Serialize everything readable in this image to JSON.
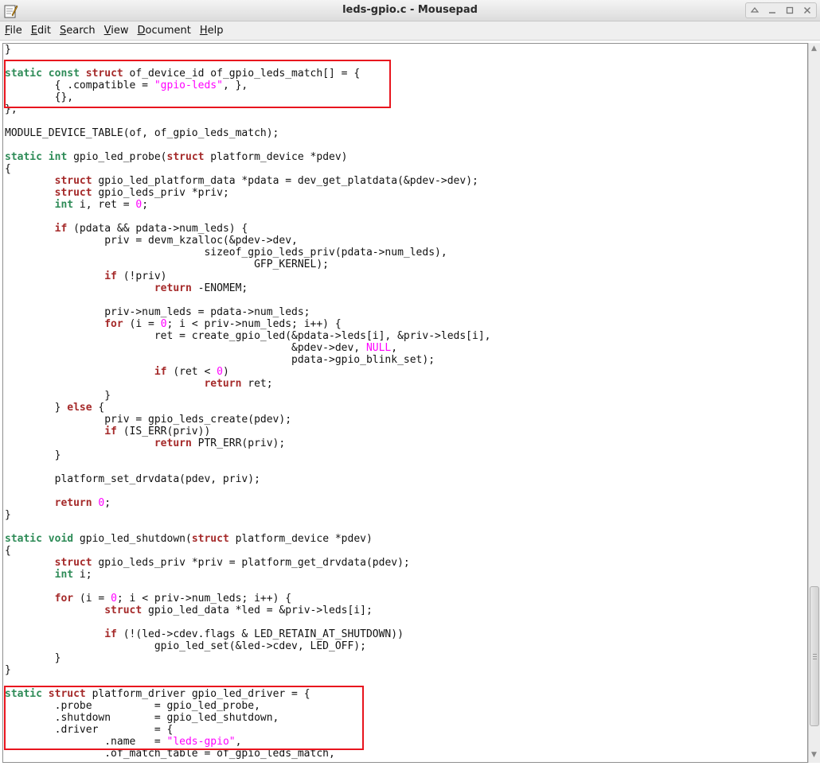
{
  "window": {
    "title": "leds-gpio.c - Mousepad",
    "controls": [
      "up-icon",
      "minimize-icon",
      "maximize-icon",
      "close-icon"
    ]
  },
  "menubar": {
    "items": [
      {
        "label": "File",
        "mnemonic": "F",
        "rest": "ile"
      },
      {
        "label": "Edit",
        "mnemonic": "E",
        "rest": "dit"
      },
      {
        "label": "Search",
        "mnemonic": "S",
        "rest": "earch"
      },
      {
        "label": "View",
        "mnemonic": "V",
        "rest": "iew"
      },
      {
        "label": "Document",
        "mnemonic": "D",
        "rest": "ocument"
      },
      {
        "label": "Help",
        "mnemonic": "H",
        "rest": "elp"
      }
    ]
  },
  "editor": {
    "file": "leds-gpio.c",
    "lines": [
      [
        [
          "}",
          ""
        ]
      ],
      [
        [
          "",
          ""
        ]
      ],
      [
        [
          "static",
          "ty"
        ],
        [
          " ",
          ""
        ],
        [
          "const",
          "ty"
        ],
        [
          " ",
          ""
        ],
        [
          "struct",
          "kw"
        ],
        [
          " of_device_id of_gpio_leds_match[] = {",
          ""
        ]
      ],
      [
        [
          "\t{ .compatible = ",
          ""
        ],
        [
          "\"gpio-leds\"",
          "str"
        ],
        [
          ", },",
          ""
        ]
      ],
      [
        [
          "\t{},",
          ""
        ]
      ],
      [
        [
          "};",
          ""
        ]
      ],
      [
        [
          "",
          ""
        ]
      ],
      [
        [
          "MODULE_DEVICE_TABLE(of, of_gpio_leds_match);",
          ""
        ]
      ],
      [
        [
          "",
          ""
        ]
      ],
      [
        [
          "static",
          "ty"
        ],
        [
          " ",
          ""
        ],
        [
          "int",
          "ty"
        ],
        [
          " gpio_led_probe(",
          ""
        ],
        [
          "struct",
          "kw"
        ],
        [
          " platform_device *pdev)",
          ""
        ]
      ],
      [
        [
          "{",
          ""
        ]
      ],
      [
        [
          "\t",
          ""
        ],
        [
          "struct",
          "kw"
        ],
        [
          " gpio_led_platform_data *pdata = dev_get_platdata(&pdev->dev);",
          ""
        ]
      ],
      [
        [
          "\t",
          ""
        ],
        [
          "struct",
          "kw"
        ],
        [
          " gpio_leds_priv *priv;",
          ""
        ]
      ],
      [
        [
          "\t",
          ""
        ],
        [
          "int",
          "ty"
        ],
        [
          " i, ret = ",
          ""
        ],
        [
          "0",
          "num"
        ],
        [
          ";",
          ""
        ]
      ],
      [
        [
          "",
          ""
        ]
      ],
      [
        [
          "\t",
          ""
        ],
        [
          "if",
          "kw"
        ],
        [
          " (pdata && pdata->num_leds) {",
          ""
        ]
      ],
      [
        [
          "\t\tpriv = devm_kzalloc(&pdev->dev,",
          ""
        ]
      ],
      [
        [
          "\t\t\t\tsizeof_gpio_leds_priv(pdata->num_leds),",
          ""
        ]
      ],
      [
        [
          "\t\t\t\t\tGFP_KERNEL);",
          ""
        ]
      ],
      [
        [
          "\t\t",
          ""
        ],
        [
          "if",
          "kw"
        ],
        [
          " (!priv)",
          ""
        ]
      ],
      [
        [
          "\t\t\t",
          ""
        ],
        [
          "return",
          "kw"
        ],
        [
          " -ENOMEM;",
          ""
        ]
      ],
      [
        [
          "",
          ""
        ]
      ],
      [
        [
          "\t\tpriv->num_leds = pdata->num_leds;",
          ""
        ]
      ],
      [
        [
          "\t\t",
          ""
        ],
        [
          "for",
          "kw"
        ],
        [
          " (i = ",
          ""
        ],
        [
          "0",
          "num"
        ],
        [
          "; i < priv->num_leds; i++) {",
          ""
        ]
      ],
      [
        [
          "\t\t\tret = create_gpio_led(&pdata->leds[i], &priv->leds[i],",
          ""
        ]
      ],
      [
        [
          "\t\t\t\t\t      &pdev->dev, ",
          ""
        ],
        [
          "NULL",
          "num"
        ],
        [
          ",",
          ""
        ]
      ],
      [
        [
          "\t\t\t\t\t      pdata->gpio_blink_set);",
          ""
        ]
      ],
      [
        [
          "\t\t\t",
          ""
        ],
        [
          "if",
          "kw"
        ],
        [
          " (ret < ",
          ""
        ],
        [
          "0",
          "num"
        ],
        [
          ")",
          ""
        ]
      ],
      [
        [
          "\t\t\t\t",
          ""
        ],
        [
          "return",
          "kw"
        ],
        [
          " ret;",
          ""
        ]
      ],
      [
        [
          "\t\t}",
          ""
        ]
      ],
      [
        [
          "\t} ",
          ""
        ],
        [
          "else",
          "kw"
        ],
        [
          " {",
          ""
        ]
      ],
      [
        [
          "\t\tpriv = gpio_leds_create(pdev);",
          ""
        ]
      ],
      [
        [
          "\t\t",
          ""
        ],
        [
          "if",
          "kw"
        ],
        [
          " (IS_ERR(priv))",
          ""
        ]
      ],
      [
        [
          "\t\t\t",
          ""
        ],
        [
          "return",
          "kw"
        ],
        [
          " PTR_ERR(priv);",
          ""
        ]
      ],
      [
        [
          "\t}",
          ""
        ]
      ],
      [
        [
          "",
          ""
        ]
      ],
      [
        [
          "\tplatform_set_drvdata(pdev, priv);",
          ""
        ]
      ],
      [
        [
          "",
          ""
        ]
      ],
      [
        [
          "\t",
          ""
        ],
        [
          "return",
          "kw"
        ],
        [
          " ",
          ""
        ],
        [
          "0",
          "num"
        ],
        [
          ";",
          ""
        ]
      ],
      [
        [
          "}",
          ""
        ]
      ],
      [
        [
          "",
          ""
        ]
      ],
      [
        [
          "static",
          "ty"
        ],
        [
          " ",
          ""
        ],
        [
          "void",
          "ty"
        ],
        [
          " gpio_led_shutdown(",
          ""
        ],
        [
          "struct",
          "kw"
        ],
        [
          " platform_device *pdev)",
          ""
        ]
      ],
      [
        [
          "{",
          ""
        ]
      ],
      [
        [
          "\t",
          ""
        ],
        [
          "struct",
          "kw"
        ],
        [
          " gpio_leds_priv *priv = platform_get_drvdata(pdev);",
          ""
        ]
      ],
      [
        [
          "\t",
          ""
        ],
        [
          "int",
          "ty"
        ],
        [
          " i;",
          ""
        ]
      ],
      [
        [
          "",
          ""
        ]
      ],
      [
        [
          "\t",
          ""
        ],
        [
          "for",
          "kw"
        ],
        [
          " (i = ",
          ""
        ],
        [
          "0",
          "num"
        ],
        [
          "; i < priv->num_leds; i++) {",
          ""
        ]
      ],
      [
        [
          "\t\t",
          ""
        ],
        [
          "struct",
          "kw"
        ],
        [
          " gpio_led_data *led = &priv->leds[i];",
          ""
        ]
      ],
      [
        [
          "",
          ""
        ]
      ],
      [
        [
          "\t\t",
          ""
        ],
        [
          "if",
          "kw"
        ],
        [
          " (!(led->cdev.flags & LED_RETAIN_AT_SHUTDOWN))",
          ""
        ]
      ],
      [
        [
          "\t\t\tgpio_led_set(&led->cdev, LED_OFF);",
          ""
        ]
      ],
      [
        [
          "\t}",
          ""
        ]
      ],
      [
        [
          "}",
          ""
        ]
      ],
      [
        [
          "",
          ""
        ]
      ],
      [
        [
          "static",
          "ty"
        ],
        [
          " ",
          ""
        ],
        [
          "struct",
          "kw"
        ],
        [
          " platform_driver gpio_led_driver = {",
          ""
        ]
      ],
      [
        [
          "\t.probe\t\t= gpio_led_probe,",
          ""
        ]
      ],
      [
        [
          "\t.shutdown\t= gpio_led_shutdown,",
          ""
        ]
      ],
      [
        [
          "\t.driver\t\t= {",
          ""
        ]
      ],
      [
        [
          "\t\t.name\t= ",
          ""
        ],
        [
          "\"leds-gpio\"",
          "str"
        ],
        [
          ",",
          ""
        ]
      ],
      [
        [
          "\t\t.of_match_table = of_gpio_leds_match,",
          ""
        ]
      ]
    ]
  },
  "colors": {
    "keyword": "#a52a2a",
    "type": "#2e8b57",
    "literal": "#ff00ff",
    "highlight_box": "#e8151e"
  }
}
